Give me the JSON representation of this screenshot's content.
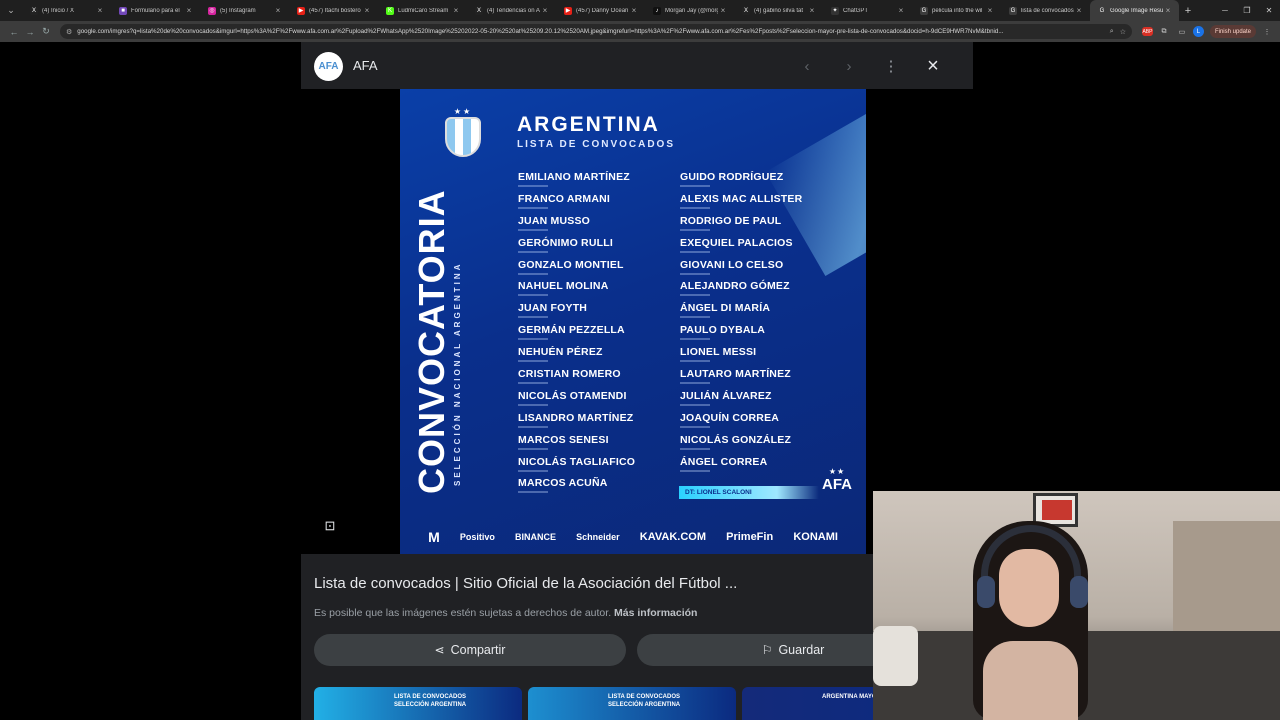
{
  "browser": {
    "tabs": [
      {
        "label": "(4) Inicio / X",
        "fav": "X",
        "fav_color": "#222222",
        "active": false
      },
      {
        "label": "Formulario para el",
        "fav": "■",
        "fav_color": "#7248b9",
        "active": false
      },
      {
        "label": "(5) Instagram",
        "fav": "◎",
        "fav_color": "#d6249f",
        "active": false
      },
      {
        "label": "(457) Itachi bostero",
        "fav": "▶",
        "fav_color": "#e62117",
        "active": false
      },
      {
        "label": "LudmiCaro Stream",
        "fav": "K",
        "fav_color": "#53fc18",
        "active": false
      },
      {
        "label": "(4) Tendencias on A",
        "fav": "X",
        "fav_color": "#222222",
        "active": false
      },
      {
        "label": "(457) Danny Ocean",
        "fav": "▶",
        "fav_color": "#e62117",
        "active": false
      },
      {
        "label": "Morgan Jay (@morg",
        "fav": "♪",
        "fav_color": "#111111",
        "active": false
      },
      {
        "label": "(4) gabino silva tat",
        "fav": "X",
        "fav_color": "#222222",
        "active": false
      },
      {
        "label": "ChatGPT",
        "fav": "✦",
        "fav_color": "#333333",
        "active": false
      },
      {
        "label": "pelicula into the wil",
        "fav": "G",
        "fav_color": "#3c3c3c",
        "active": false
      },
      {
        "label": "lista de convocados",
        "fav": "G",
        "fav_color": "#3c3c3c",
        "active": false
      },
      {
        "label": "Google Image Resu",
        "fav": "G",
        "fav_color": "#3c3c3c",
        "active": true
      }
    ],
    "url": "google.com/imgres?q=lista%20de%20convocados&imgurl=https%3A%2F%2Fwww.afa.com.ar%2Fupload%2FWhatsApp%2520Image%25202022-05-20%2520at%25209.20.12%2520AM.jpeg&imgrefurl=https%3A%2F%2Fwww.afa.com.ar%2Fes%2Fposts%2Fseleccion-mayor-pre-lista-de-convocados&docid=h-9dCE9HWR7NvM&tbnid...",
    "update_label": "Finish update",
    "avatar_letter": "L"
  },
  "viewer": {
    "site_name": "AFA",
    "site_logo_text": "AFA",
    "image_title": "Lista de convocados | Sitio Oficial de la Asociación del Fútbol ...",
    "copyright_note": "Es posible que las imágenes estén sujetas a derechos de autor.",
    "more_info": "Más información",
    "share_label": "Compartir",
    "save_label": "Guardar",
    "related": [
      {
        "line1": "LISTA DE CONVOCADOS",
        "line2": "SELECCIÓN ARGENTINA",
        "bg": "#22b0e6"
      },
      {
        "line1": "LISTA DE CONVOCADOS",
        "line2": "SELECCIÓN ARGENTINA",
        "bg": "#1d8fd0"
      },
      {
        "line1": "ARGENTINA MAYOR",
        "line2": "",
        "bg": "#142a7a"
      }
    ]
  },
  "poster": {
    "title": "ARGENTINA",
    "subtitle": "LISTA DE CONVOCADOS",
    "vertical_big": "CONVOCATORIA",
    "vertical_small": "SELECCIÓN NACIONAL ARGENTINA",
    "left_players": [
      "EMILIANO MARTÍNEZ",
      "FRANCO ARMANI",
      "JUAN MUSSO",
      "GERÓNIMO RULLI",
      "GONZALO MONTIEL",
      "NAHUEL MOLINA",
      "JUAN FOYTH",
      "GERMÁN PEZZELLA",
      "NEHUÉN PÉREZ",
      "CRISTIAN ROMERO",
      "NICOLÁS OTAMENDI",
      "LISANDRO MARTÍNEZ",
      "MARCOS SENESI",
      "NICOLÁS TAGLIAFICO",
      "MARCOS ACUÑA"
    ],
    "right_players": [
      "GUIDO RODRÍGUEZ",
      "ALEXIS MAC ALLISTER",
      "RODRIGO DE PAUL",
      "EXEQUIEL PALACIOS",
      "GIOVANI LO CELSO",
      "ALEJANDRO GÓMEZ",
      "ÁNGEL DI MARÍA",
      "PAULO DYBALA",
      "LIONEL MESSI",
      "LAUTARO MARTÍNEZ",
      "JULIÁN ÁLVAREZ",
      "JOAQUÍN CORREA",
      "NICOLÁS GONZÁLEZ",
      "ÁNGEL CORREA"
    ],
    "coach": "DT: LIONEL SCALONI",
    "afa": "AFA",
    "sponsors": [
      "M",
      "Positivo",
      "BINANCE",
      "Schneider",
      "KAVAK.COM",
      "PrimeFin",
      "KONAMI"
    ]
  }
}
